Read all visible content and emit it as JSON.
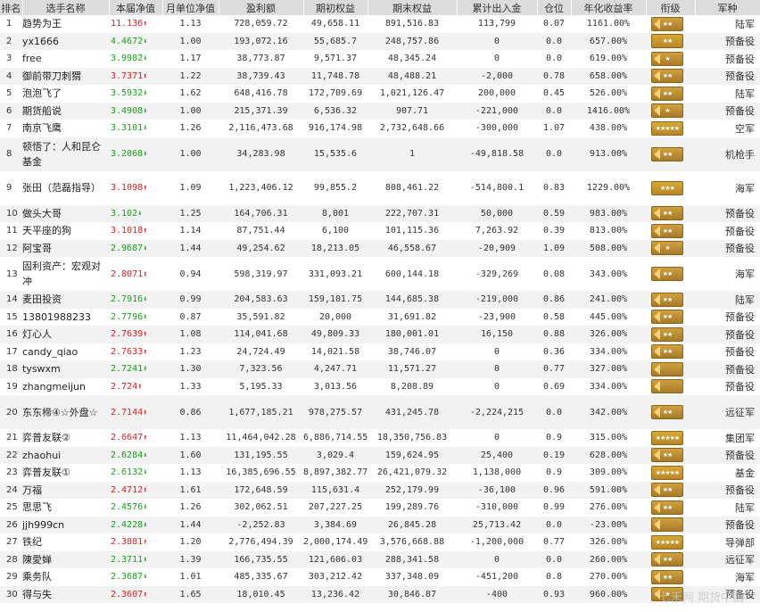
{
  "headers": [
    "排名",
    "选手名称",
    "本届净值",
    "月单位净值",
    "盈利额",
    "期初权益",
    "期末权益",
    "累计出入金",
    "仓位",
    "年化收益率",
    "衔级",
    "军种"
  ],
  "rows": [
    {
      "rank": "1",
      "name": "趋势为王",
      "nav": "11.136",
      "dir": "up",
      "unit": "1.13",
      "profit": "728,059.72",
      "start": "49,658.11",
      "end": "891,516.83",
      "flow": "113,799",
      "pos": "0.07",
      "ann": "1161.00%",
      "badge": "chev-2star",
      "branch": "陆军"
    },
    {
      "rank": "2",
      "name": "yx1666",
      "nav": "4.4672",
      "dir": "down",
      "unit": "1.00",
      "profit": "193,072.16",
      "start": "55,685.7",
      "end": "248,757.86",
      "flow": "0",
      "pos": "0.0",
      "ann": "657.00%",
      "badge": "2star",
      "branch": "预备役"
    },
    {
      "rank": "3",
      "name": "free",
      "nav": "3.9982",
      "dir": "down",
      "unit": "1.17",
      "profit": "38,773.87",
      "start": "9,571.37",
      "end": "48,345.24",
      "flow": "0",
      "pos": "0.0",
      "ann": "619.00%",
      "badge": "chev-1star",
      "branch": "预备役"
    },
    {
      "rank": "4",
      "name": "御前带刀刺猬",
      "nav": "3.7371",
      "dir": "up",
      "unit": "1.22",
      "profit": "38,739.43",
      "start": "11,748.78",
      "end": "48,488.21",
      "flow": "-2,000",
      "pos": "0.78",
      "ann": "658.00%",
      "badge": "chev-2star",
      "branch": "预备役"
    },
    {
      "rank": "5",
      "name": "泡泡飞了",
      "nav": "3.5932",
      "dir": "down",
      "unit": "1.62",
      "profit": "648,416.78",
      "start": "172,709.69",
      "end": "1,021,126.47",
      "flow": "200,000",
      "pos": "0.45",
      "ann": "526.00%",
      "badge": "chev-2star",
      "branch": "陆军"
    },
    {
      "rank": "6",
      "name": "期货船说",
      "nav": "3.4908",
      "dir": "down",
      "unit": "1.00",
      "profit": "215,371.39",
      "start": "6,536.32",
      "end": "907.71",
      "flow": "-221,000",
      "pos": "0.0",
      "ann": "1416.00%",
      "badge": "chev-1star",
      "branch": "预备役"
    },
    {
      "rank": "7",
      "name": "南京飞鹰",
      "nav": "3.3101",
      "dir": "down",
      "unit": "1.26",
      "profit": "2,116,473.68",
      "start": "916,174.98",
      "end": "2,732,648.66",
      "flow": "-300,000",
      "pos": "1.07",
      "ann": "438.00%",
      "badge": "5star",
      "branch": "空军"
    },
    {
      "rank": "8",
      "name": "顿悟了：人和昆仑基金",
      "nav": "3.2068",
      "dir": "down",
      "unit": "1.00",
      "profit": "34,283.98",
      "start": "15,535.6",
      "end": "1",
      "flow": "-49,818.58",
      "pos": "0.0",
      "ann": "913.00%",
      "badge": "chev-2star",
      "branch": "机枪手",
      "tall": true
    },
    {
      "rank": "9",
      "name": "张田（范磊指导）",
      "nav": "3.1098",
      "dir": "up",
      "unit": "1.09",
      "profit": "1,223,406.12",
      "start": "99,855.2",
      "end": "808,461.22",
      "flow": "-514,800.1",
      "pos": "0.83",
      "ann": "1229.00%",
      "badge": "3star",
      "branch": "海军",
      "tall": true
    },
    {
      "rank": "10",
      "name": "做头大哥",
      "nav": "3.102",
      "dir": "down",
      "unit": "1.25",
      "profit": "164,706.31",
      "start": "8,001",
      "end": "222,707.31",
      "flow": "50,000",
      "pos": "0.59",
      "ann": "983.00%",
      "badge": "chev-2star",
      "branch": "预备役"
    },
    {
      "rank": "11",
      "name": "天平座的狗",
      "nav": "3.1018",
      "dir": "up",
      "unit": "1.14",
      "profit": "87,751.44",
      "start": "6,100",
      "end": "101,115.36",
      "flow": "7,263.92",
      "pos": "0.39",
      "ann": "813.00%",
      "badge": "chev-2star",
      "branch": "预备役"
    },
    {
      "rank": "12",
      "name": "阿宝哥",
      "nav": "2.9687",
      "dir": "down",
      "unit": "1.44",
      "profit": "49,254.62",
      "start": "18,213.05",
      "end": "46,558.67",
      "flow": "-20,909",
      "pos": "1.09",
      "ann": "508.00%",
      "badge": "chev-1star",
      "branch": "预备役"
    },
    {
      "rank": "13",
      "name": "固利资产：宏观对冲",
      "nav": "2.8071",
      "dir": "up",
      "unit": "0.94",
      "profit": "598,319.97",
      "start": "331,093.21",
      "end": "600,144.18",
      "flow": "-329,269",
      "pos": "0.08",
      "ann": "343.00%",
      "badge": "chev-2star",
      "branch": "海军",
      "tall": true
    },
    {
      "rank": "14",
      "name": "麦田投资",
      "nav": "2.7916",
      "dir": "down",
      "unit": "0.99",
      "profit": "204,583.63",
      "start": "159,101.75",
      "end": "144,685.38",
      "flow": "-219,000",
      "pos": "0.86",
      "ann": "241.00%",
      "badge": "chev-2star",
      "branch": "陆军"
    },
    {
      "rank": "15",
      "name": "13801988233",
      "nav": "2.7796",
      "dir": "down",
      "unit": "0.87",
      "profit": "35,591.82",
      "start": "20,000",
      "end": "31,691.82",
      "flow": "-23,900",
      "pos": "0.58",
      "ann": "445.00%",
      "badge": "chev-2star",
      "branch": "预备役"
    },
    {
      "rank": "16",
      "name": "灯心人",
      "nav": "2.7639",
      "dir": "up",
      "unit": "1.08",
      "profit": "114,041.68",
      "start": "49,809.33",
      "end": "180,001.01",
      "flow": "16,150",
      "pos": "0.88",
      "ann": "326.00%",
      "badge": "chev-2star",
      "branch": "预备役"
    },
    {
      "rank": "17",
      "name": "candy_qiao",
      "nav": "2.7633",
      "dir": "up",
      "unit": "1.23",
      "profit": "24,724.49",
      "start": "14,021.58",
      "end": "38,746.07",
      "flow": "0",
      "pos": "0.36",
      "ann": "334.00%",
      "badge": "chev-2star",
      "branch": "预备役"
    },
    {
      "rank": "18",
      "name": "tyswxm",
      "nav": "2.7241",
      "dir": "down",
      "unit": "1.30",
      "profit": "7,323.56",
      "start": "4,247.71",
      "end": "11,571.27",
      "flow": "0",
      "pos": "0.77",
      "ann": "327.00%",
      "badge": "chev-0",
      "branch": "预备役"
    },
    {
      "rank": "19",
      "name": "zhangmeijun",
      "nav": "2.724",
      "dir": "up",
      "unit": "1.33",
      "profit": "5,195.33",
      "start": "3,013.56",
      "end": "8,208.89",
      "flow": "0",
      "pos": "0.69",
      "ann": "334.00%",
      "badge": "chev-0",
      "branch": "预备役"
    },
    {
      "rank": "20",
      "name": "东东楴④☆外盘☆",
      "nav": "2.7144",
      "dir": "up",
      "unit": "0.86",
      "profit": "1,677,185.21",
      "start": "978,275.57",
      "end": "431,245.78",
      "flow": "-2,224,215",
      "pos": "0.0",
      "ann": "342.00%",
      "badge": "chev-2star",
      "branch": "远征军",
      "tall": true
    },
    {
      "rank": "21",
      "name": "弈普友联②",
      "nav": "2.6647",
      "dir": "up",
      "unit": "1.13",
      "profit": "11,464,042.28",
      "start": "6,886,714.55",
      "end": "18,350,756.83",
      "flow": "0",
      "pos": "0.9",
      "ann": "315.00%",
      "badge": "5star",
      "branch": "集团军"
    },
    {
      "rank": "22",
      "name": "zhaohui",
      "nav": "2.6284",
      "dir": "down",
      "unit": "1.60",
      "profit": "131,195.55",
      "start": "3,029.4",
      "end": "159,624.95",
      "flow": "25,400",
      "pos": "0.19",
      "ann": "628.00%",
      "badge": "chev-2star",
      "branch": "预备役"
    },
    {
      "rank": "23",
      "name": "弈普友联①",
      "nav": "2.6132",
      "dir": "down",
      "unit": "1.13",
      "profit": "16,385,696.55",
      "start": "8,897,382.77",
      "end": "26,421,079.32",
      "flow": "1,138,000",
      "pos": "0.9",
      "ann": "309.00%",
      "badge": "5star",
      "branch": "基金"
    },
    {
      "rank": "24",
      "name": "万福",
      "nav": "2.4712",
      "dir": "up",
      "unit": "1.61",
      "profit": "172,648.59",
      "start": "115,631.4",
      "end": "252,179.99",
      "flow": "-36,100",
      "pos": "0.96",
      "ann": "591.00%",
      "badge": "chev-2star",
      "branch": "预备役"
    },
    {
      "rank": "25",
      "name": "思思飞",
      "nav": "2.4576",
      "dir": "down",
      "unit": "1.26",
      "profit": "302,062.51",
      "start": "207,227.25",
      "end": "199,289.76",
      "flow": "-310,000",
      "pos": "0.99",
      "ann": "276.00%",
      "badge": "chev-2star",
      "branch": "陆军"
    },
    {
      "rank": "26",
      "name": "jjh999cn",
      "nav": "2.4228",
      "dir": "down",
      "unit": "1.44",
      "profit": "-2,252.83",
      "start": "3,384.69",
      "end": "26,845.28",
      "flow": "25,713.42",
      "pos": "0.0",
      "ann": "-23.00%",
      "badge": "chev-0",
      "branch": "预备役"
    },
    {
      "rank": "27",
      "name": "铁纪",
      "nav": "2.3881",
      "dir": "up",
      "unit": "1.20",
      "profit": "2,776,494.39",
      "start": "2,000,174.49",
      "end": "3,576,668.88",
      "flow": "-1,200,000",
      "pos": "0.77",
      "ann": "326.00%",
      "badge": "5star",
      "branch": "导弹部"
    },
    {
      "rank": "28",
      "name": "陳愛婵",
      "nav": "2.3711",
      "dir": "down",
      "unit": "1.39",
      "profit": "166,735.55",
      "start": "121,606.03",
      "end": "288,341.58",
      "flow": "0",
      "pos": "0.0",
      "ann": "260.00%",
      "badge": "chev-2star",
      "branch": "远征军"
    },
    {
      "rank": "29",
      "name": "乘务队",
      "nav": "2.3687",
      "dir": "down",
      "unit": "1.01",
      "profit": "485,335.67",
      "start": "303,212.42",
      "end": "337,348.09",
      "flow": "-451,200",
      "pos": "0.8",
      "ann": "270.00%",
      "badge": "chev-2star",
      "branch": "海军"
    },
    {
      "rank": "30",
      "name": "得与失",
      "nav": "2.3607",
      "dir": "up",
      "unit": "1.65",
      "profit": "18,010.45",
      "start": "13,236.42",
      "end": "30,846.87",
      "flow": "-400",
      "pos": "0.93",
      "ann": "960.00%",
      "badge": "chev-1star",
      "branch": "预备役"
    }
  ],
  "watermark": "七禾网 期货中国"
}
